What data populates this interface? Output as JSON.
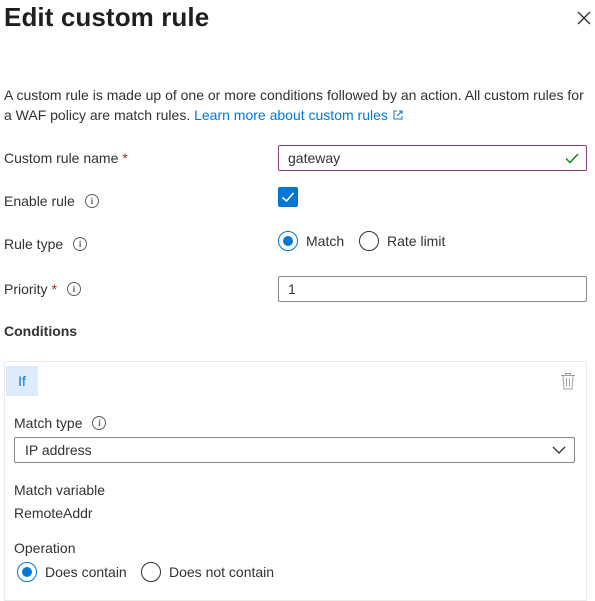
{
  "panel": {
    "title": "Edit custom rule",
    "description": "A custom rule is made up of one or more conditions followed by an action. All custom rules for a WAF policy are match rules.",
    "learn_more_link": "Learn more about custom rules"
  },
  "form": {
    "custom_rule_name": {
      "label": "Custom rule name",
      "required_marker": "*",
      "value": "gateway"
    },
    "enable_rule": {
      "label": "Enable rule",
      "checked": true
    },
    "rule_type": {
      "label": "Rule type",
      "options": [
        "Match",
        "Rate limit"
      ],
      "selected": "Match"
    },
    "priority": {
      "label": "Priority",
      "required_marker": "*",
      "value": "1"
    }
  },
  "conditions": {
    "heading": "Conditions",
    "if_label": "If",
    "match_type": {
      "label": "Match type",
      "value": "IP address"
    },
    "match_variable": {
      "label": "Match variable",
      "value": "RemoteAddr"
    },
    "operation": {
      "label": "Operation",
      "options": [
        "Does contain",
        "Does not contain"
      ],
      "selected": "Does contain"
    }
  },
  "colors": {
    "accent": "#0078d4",
    "required": "#a4262c",
    "valid_check": "#107c10",
    "if_badge_bg": "#deecf9"
  },
  "icons": [
    "close-icon",
    "info-icon",
    "external-link-icon",
    "checkmark-icon",
    "delete-icon",
    "chevron-down-icon"
  ]
}
